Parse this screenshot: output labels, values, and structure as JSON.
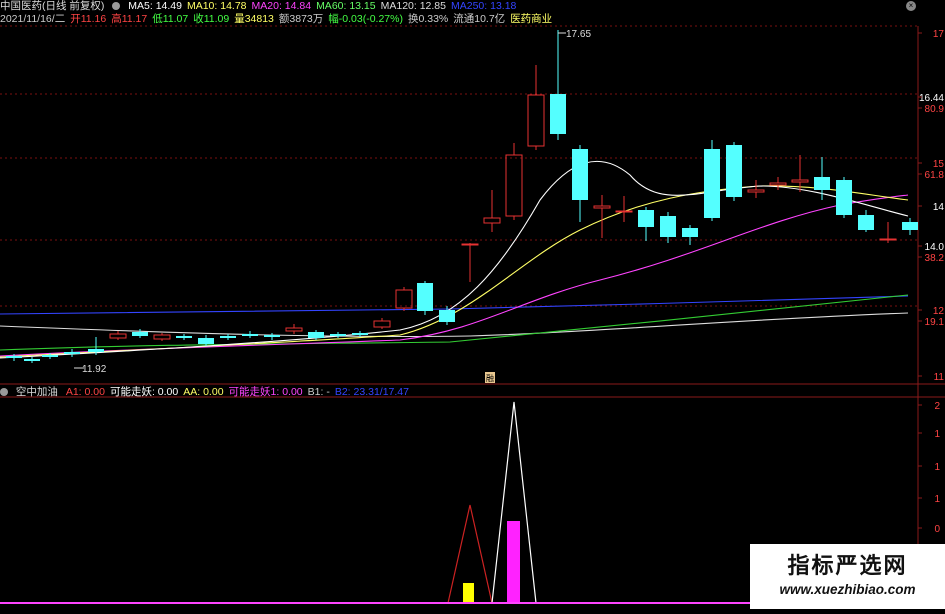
{
  "header": {
    "stock_name": "中国医药(日线 前复权)",
    "ma_items": [
      {
        "label": "MA5: 14.49",
        "color": "#ffffff"
      },
      {
        "label": "MA10: 14.78",
        "color": "#ffff66"
      },
      {
        "label": "MA20: 14.84",
        "color": "#ff44ff"
      },
      {
        "label": "MA60: 13.15",
        "color": "#66ff66"
      },
      {
        "label": "MA120: 12.85",
        "color": "#dddddd"
      },
      {
        "label": "MA250: 13.18",
        "color": "#3344ff"
      }
    ],
    "close_icon": "close-icon"
  },
  "quote": {
    "items": [
      {
        "label": "2021/11/16/二",
        "color": "#cccccc"
      },
      {
        "label": "开11.16",
        "color": "#ff4444"
      },
      {
        "label": "高11.17",
        "color": "#ff4444"
      },
      {
        "label": "低11.07",
        "color": "#44ff44"
      },
      {
        "label": "收11.09",
        "color": "#44ff44"
      },
      {
        "label": "量34813",
        "color": "#ffff66"
      },
      {
        "label": "额3873万",
        "color": "#cccccc"
      },
      {
        "label": "幅-0.03(-0.27%)",
        "color": "#44ff44"
      },
      {
        "label": "换0.33%",
        "color": "#cccccc"
      },
      {
        "label": "流通10.7亿",
        "color": "#cccccc"
      },
      {
        "label": "医药商业",
        "color": "#ffff66"
      }
    ]
  },
  "price_axis": {
    "labels": [
      "17",
      "16.44",
      "80.9",
      "15",
      "61.8",
      "14",
      "14.0",
      "38.2",
      "12",
      "19.1",
      "11"
    ],
    "colors": [
      "#ff4444",
      "#ffffff",
      "#ff4444",
      "#ff4444",
      "#ff4444",
      "#ffffff",
      "#ffffff",
      "#ff4444",
      "#ff4444",
      "#ff4444",
      "#ff4444"
    ]
  },
  "annotations": {
    "high_label": "17.65",
    "low_label": "11.92",
    "marker_label": "融"
  },
  "indicator": {
    "name": "空中加油",
    "items": [
      {
        "label": "A1: 0.00",
        "color": "#ff4444"
      },
      {
        "label": "可能走妖: 0.00",
        "color": "#ffffff"
      },
      {
        "label": "AA: 0.00",
        "color": "#ffff66"
      },
      {
        "label": "可能走妖1: 0.00",
        "color": "#ff44ff"
      },
      {
        "label": "B1: -",
        "color": "#cccccc"
      },
      {
        "label": "B2: 23.31/17.47",
        "color": "#3344ff"
      }
    ],
    "axis_labels": [
      "2",
      "1",
      "1",
      "1",
      "0",
      "0"
    ]
  },
  "watermark": {
    "title": "指标严选网",
    "url": "www.xuezhibiao.com"
  },
  "colors": {
    "up": "#e63232",
    "down": "#54ffff",
    "grid": "#7a1010",
    "ma5": "#ffffff",
    "ma10": "#ffff66",
    "ma20": "#ff44ff",
    "ma60": "#33cc33",
    "ma120": "#dddddd",
    "ma250": "#3344ff"
  }
}
